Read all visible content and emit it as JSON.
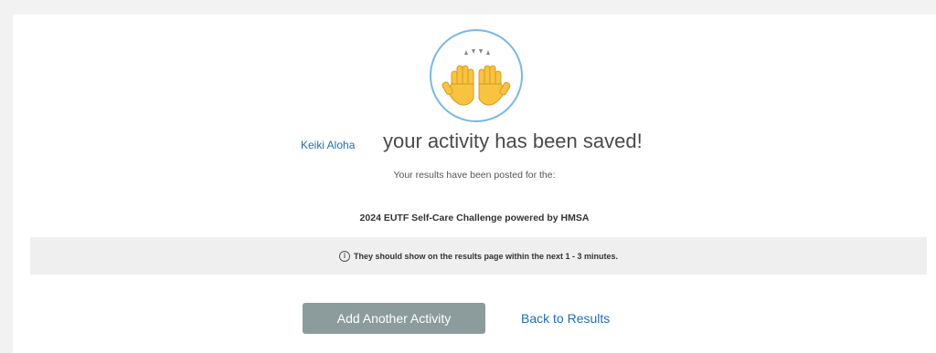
{
  "confirmation": {
    "user_name": "Keiki Aloha",
    "headline": "your activity has been saved!",
    "subtext": "Your results have been posted for the:",
    "challenge_name": "2024 EUTF Self-Care Challenge powered by HMSA",
    "notice_icon_glyph": "i",
    "notice": "They should show on the results page within the next 1 - 3 minutes."
  },
  "actions": {
    "add_another": "Add Another Activity",
    "back_to_results": "Back to Results"
  },
  "icons": {
    "celebration": "raising-hands-icon",
    "notice": "info-icon"
  },
  "colors": {
    "link": "#1f6fb2",
    "button_bg": "#8c9c9c",
    "circle_border": "#7ab8e0",
    "notice_bg": "#efefef"
  }
}
